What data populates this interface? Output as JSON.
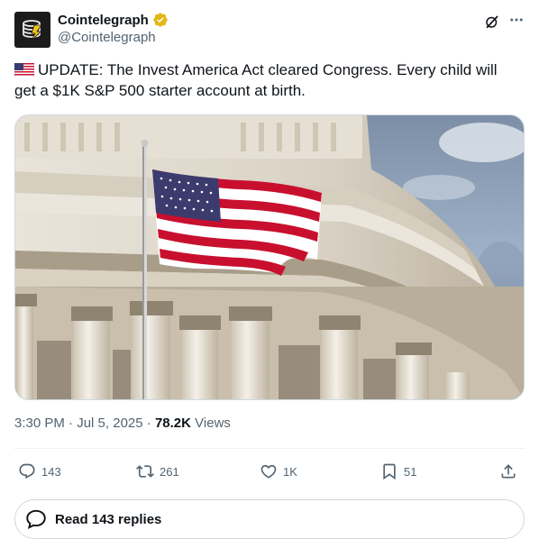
{
  "account": {
    "display_name": "Cointelegraph",
    "handle": "@Cointelegraph",
    "verified_color": "#e2b719"
  },
  "tweet": {
    "flag_emoji": "us-flag-emoji",
    "text": "UPDATE: The Invest America Act cleared Congress. Every child will get a $1K S&P 500 starter account at birth.",
    "time": "3:30 PM",
    "date": "Jul 5, 2025",
    "separator": "·",
    "views_count": "78.2K",
    "views_label": "Views"
  },
  "actions": {
    "replies": "143",
    "reposts": "261",
    "likes": "1K",
    "bookmarks": "51"
  },
  "read_replies": {
    "label": "Read 143 replies"
  },
  "colors": {
    "text_primary": "#0f1419",
    "text_secondary": "#536471",
    "border": "#cfd9de"
  }
}
